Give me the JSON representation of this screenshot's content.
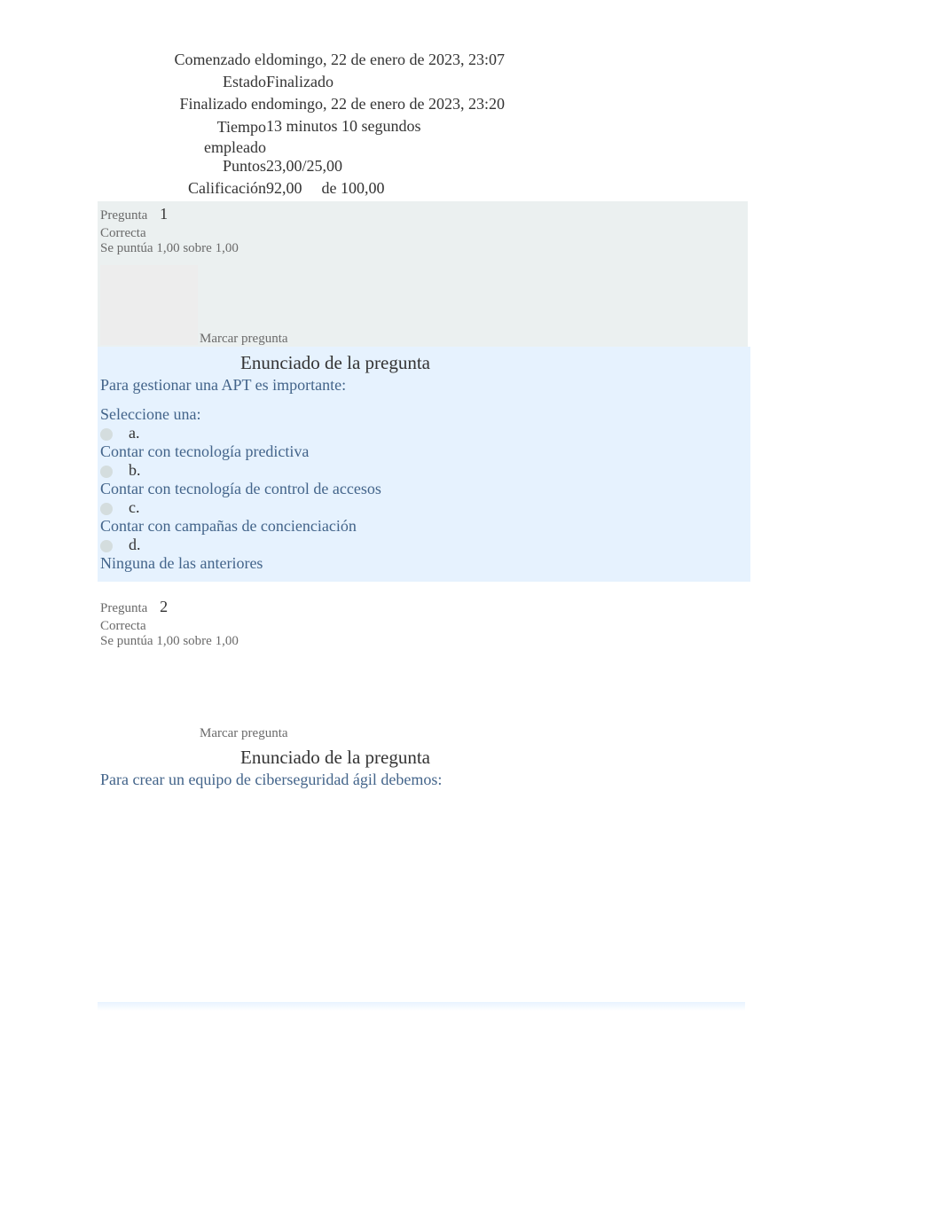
{
  "summary": {
    "started_label": "Comenzado el",
    "started_value": "domingo, 22 de enero de 2023, 23:07",
    "state_label": "Estado",
    "state_value": "Finalizado",
    "finished_label": "Finalizado en",
    "finished_value": "domingo, 22 de enero de 2023, 23:20",
    "time_label_line1": "Tiempo",
    "time_label_line2": "empleado",
    "time_value": "13 minutos 10 segundos",
    "points_label": "Puntos",
    "points_value": "23,00/25,00",
    "grade_label": "Calificación",
    "grade_score": "92,00",
    "grade_of": "de 100,00"
  },
  "question1": {
    "label": "Pregunta",
    "number": "1",
    "correct": "Correcta",
    "points": "Se puntúa 1,00 sobre 1,00",
    "flag": "Marcar pregunta",
    "enunciado_title": "Enunciado de la pregunta",
    "text": "Para gestionar una APT es importante:",
    "select": "Seleccione una:",
    "options": [
      {
        "letter": "a.",
        "text": "Contar con tecnología predictiva"
      },
      {
        "letter": "b.",
        "text": "Contar con tecnología de control de accesos"
      },
      {
        "letter": "c.",
        "text": "Contar con campañas de concienciación"
      },
      {
        "letter": "d.",
        "text": "Ninguna de las anteriores"
      }
    ]
  },
  "question2": {
    "label": "Pregunta",
    "number": "2",
    "correct": "Correcta",
    "points": "Se puntúa 1,00 sobre 1,00",
    "flag": "Marcar pregunta",
    "enunciado_title": "Enunciado de la pregunta",
    "text": "Para crear un equipo de ciberseguridad ágil debemos:"
  }
}
